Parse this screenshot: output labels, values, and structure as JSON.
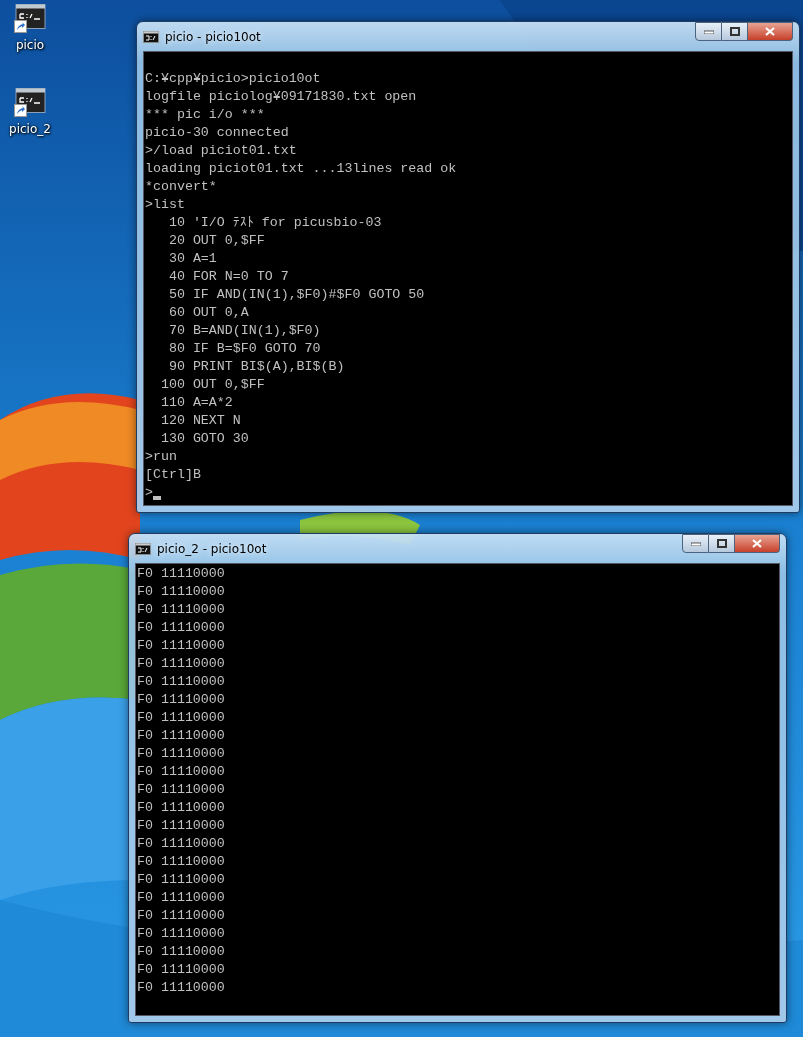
{
  "desktop_icons": [
    {
      "label": "picio"
    },
    {
      "label": "picio_2"
    }
  ],
  "windows": [
    {
      "title": "picio - picio10ot",
      "cursor": true,
      "lines": [
        "C:¥cpp¥picio>picio10ot",
        "logfile piciolog¥09171830.txt open",
        "*** pic i/o ***",
        "picio-30 connected",
        ">/load piciot01.txt",
        "loading piciot01.txt ...13lines read ok",
        "*convert*",
        ">list",
        "   10 'I/O ﾃｽﾄ for picusbio-03",
        "   20 OUT 0,$FF",
        "   30 A=1",
        "   40 FOR N=0 TO 7",
        "   50 IF AND(IN(1),$F0)#$F0 GOTO 50",
        "   60 OUT 0,A",
        "   70 B=AND(IN(1),$F0)",
        "   80 IF B=$F0 GOTO 70",
        "   90 PRINT BI$(A),BI$(B)",
        "  100 OUT 0,$FF",
        "  110 A=A*2",
        "  120 NEXT N",
        "  130 GOTO 30",
        ">run",
        "[Ctrl]B",
        ">"
      ]
    },
    {
      "title": "picio_2 - picio10ot",
      "cursor": false,
      "lines": [
        "F0 11110000",
        "F0 11110000",
        "F0 11110000",
        "F0 11110000",
        "F0 11110000",
        "F0 11110000",
        "F0 11110000",
        "F0 11110000",
        "F0 11110000",
        "F0 11110000",
        "F0 11110000",
        "F0 11110000",
        "F0 11110000",
        "F0 11110000",
        "F0 11110000",
        "F0 11110000",
        "F0 11110000",
        "F0 11110000",
        "F0 11110000",
        "F0 11110000",
        "F0 11110000",
        "F0 11110000",
        "F0 11110000",
        "F0 11110000"
      ]
    }
  ]
}
